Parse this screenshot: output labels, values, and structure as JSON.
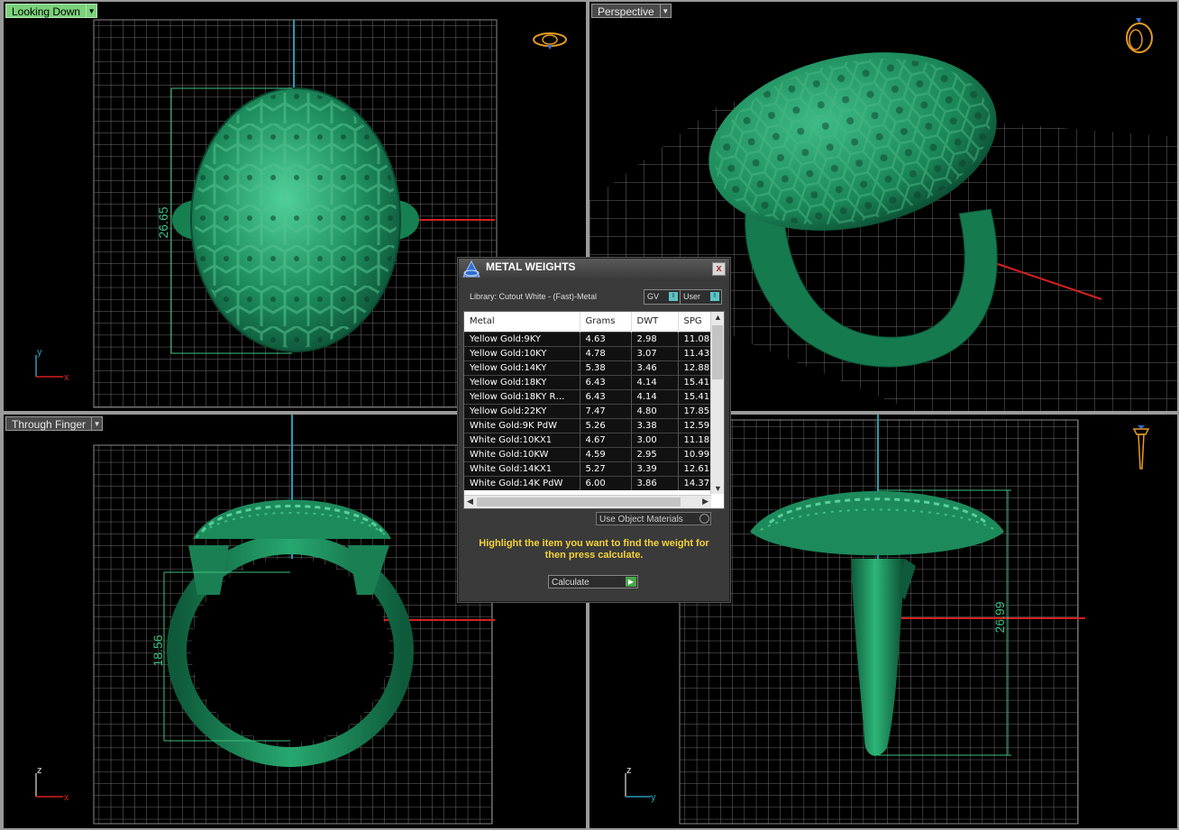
{
  "viewports": {
    "top_left": {
      "label": "Looking Down",
      "dimension": "26.65",
      "axis_v": "y",
      "axis_h": "x"
    },
    "top_right": {
      "label": "Perspective"
    },
    "bottom_left": {
      "label": "Through Finger",
      "dimension": "18.56",
      "axis_v": "z",
      "axis_h": "x"
    },
    "bottom_right": {
      "dimension": "26.99",
      "axis_v": "z",
      "axis_h": "y"
    }
  },
  "dialog": {
    "title": "METAL WEIGHTS",
    "close": "x",
    "library": "Library: Cutout White - (Fast)-Metal",
    "toggle_gv": "GV",
    "toggle_user": "User",
    "columns": [
      "Metal",
      "Grams",
      "DWT",
      "SPG"
    ],
    "rows": [
      [
        "Yellow Gold:9KY",
        "4.63",
        "2.98",
        "11.08"
      ],
      [
        "Yellow Gold:10KY",
        "4.78",
        "3.07",
        "11.43"
      ],
      [
        "Yellow Gold:14KY",
        "5.38",
        "3.46",
        "12.88"
      ],
      [
        "Yellow Gold:18KY",
        "6.43",
        "4.14",
        "15.41"
      ],
      [
        "Yellow Gold:18KY R…",
        "6.43",
        "4.14",
        "15.41"
      ],
      [
        "Yellow Gold:22KY",
        "7.47",
        "4.80",
        "17.85"
      ],
      [
        "White Gold:9K PdW",
        "5.26",
        "3.38",
        "12.59"
      ],
      [
        "White Gold:10KX1",
        "4.67",
        "3.00",
        "11.18"
      ],
      [
        "White Gold:10KW",
        "4.59",
        "2.95",
        "10.99"
      ],
      [
        "White Gold:14KX1",
        "5.27",
        "3.39",
        "12.61"
      ],
      [
        "White Gold:14K PdW",
        "6.00",
        "3.86",
        "14.37"
      ]
    ],
    "use_object_materials": "Use Object Materials",
    "hint": "Highlight the item you want to find the weight for then press calculate.",
    "calculate": "Calculate"
  },
  "icons": [
    "ring-top-view-icon",
    "ring-perspective-icon",
    "ring-side-view-icon",
    "dialog-logo-icon"
  ],
  "colors": {
    "model": "#1d8a5c",
    "grid": "#6e6e6e",
    "axis_x": "#d42020",
    "axis_y": "#2a9bb3",
    "active_label": "#7ad27a",
    "hint": "#f4d23a"
  }
}
